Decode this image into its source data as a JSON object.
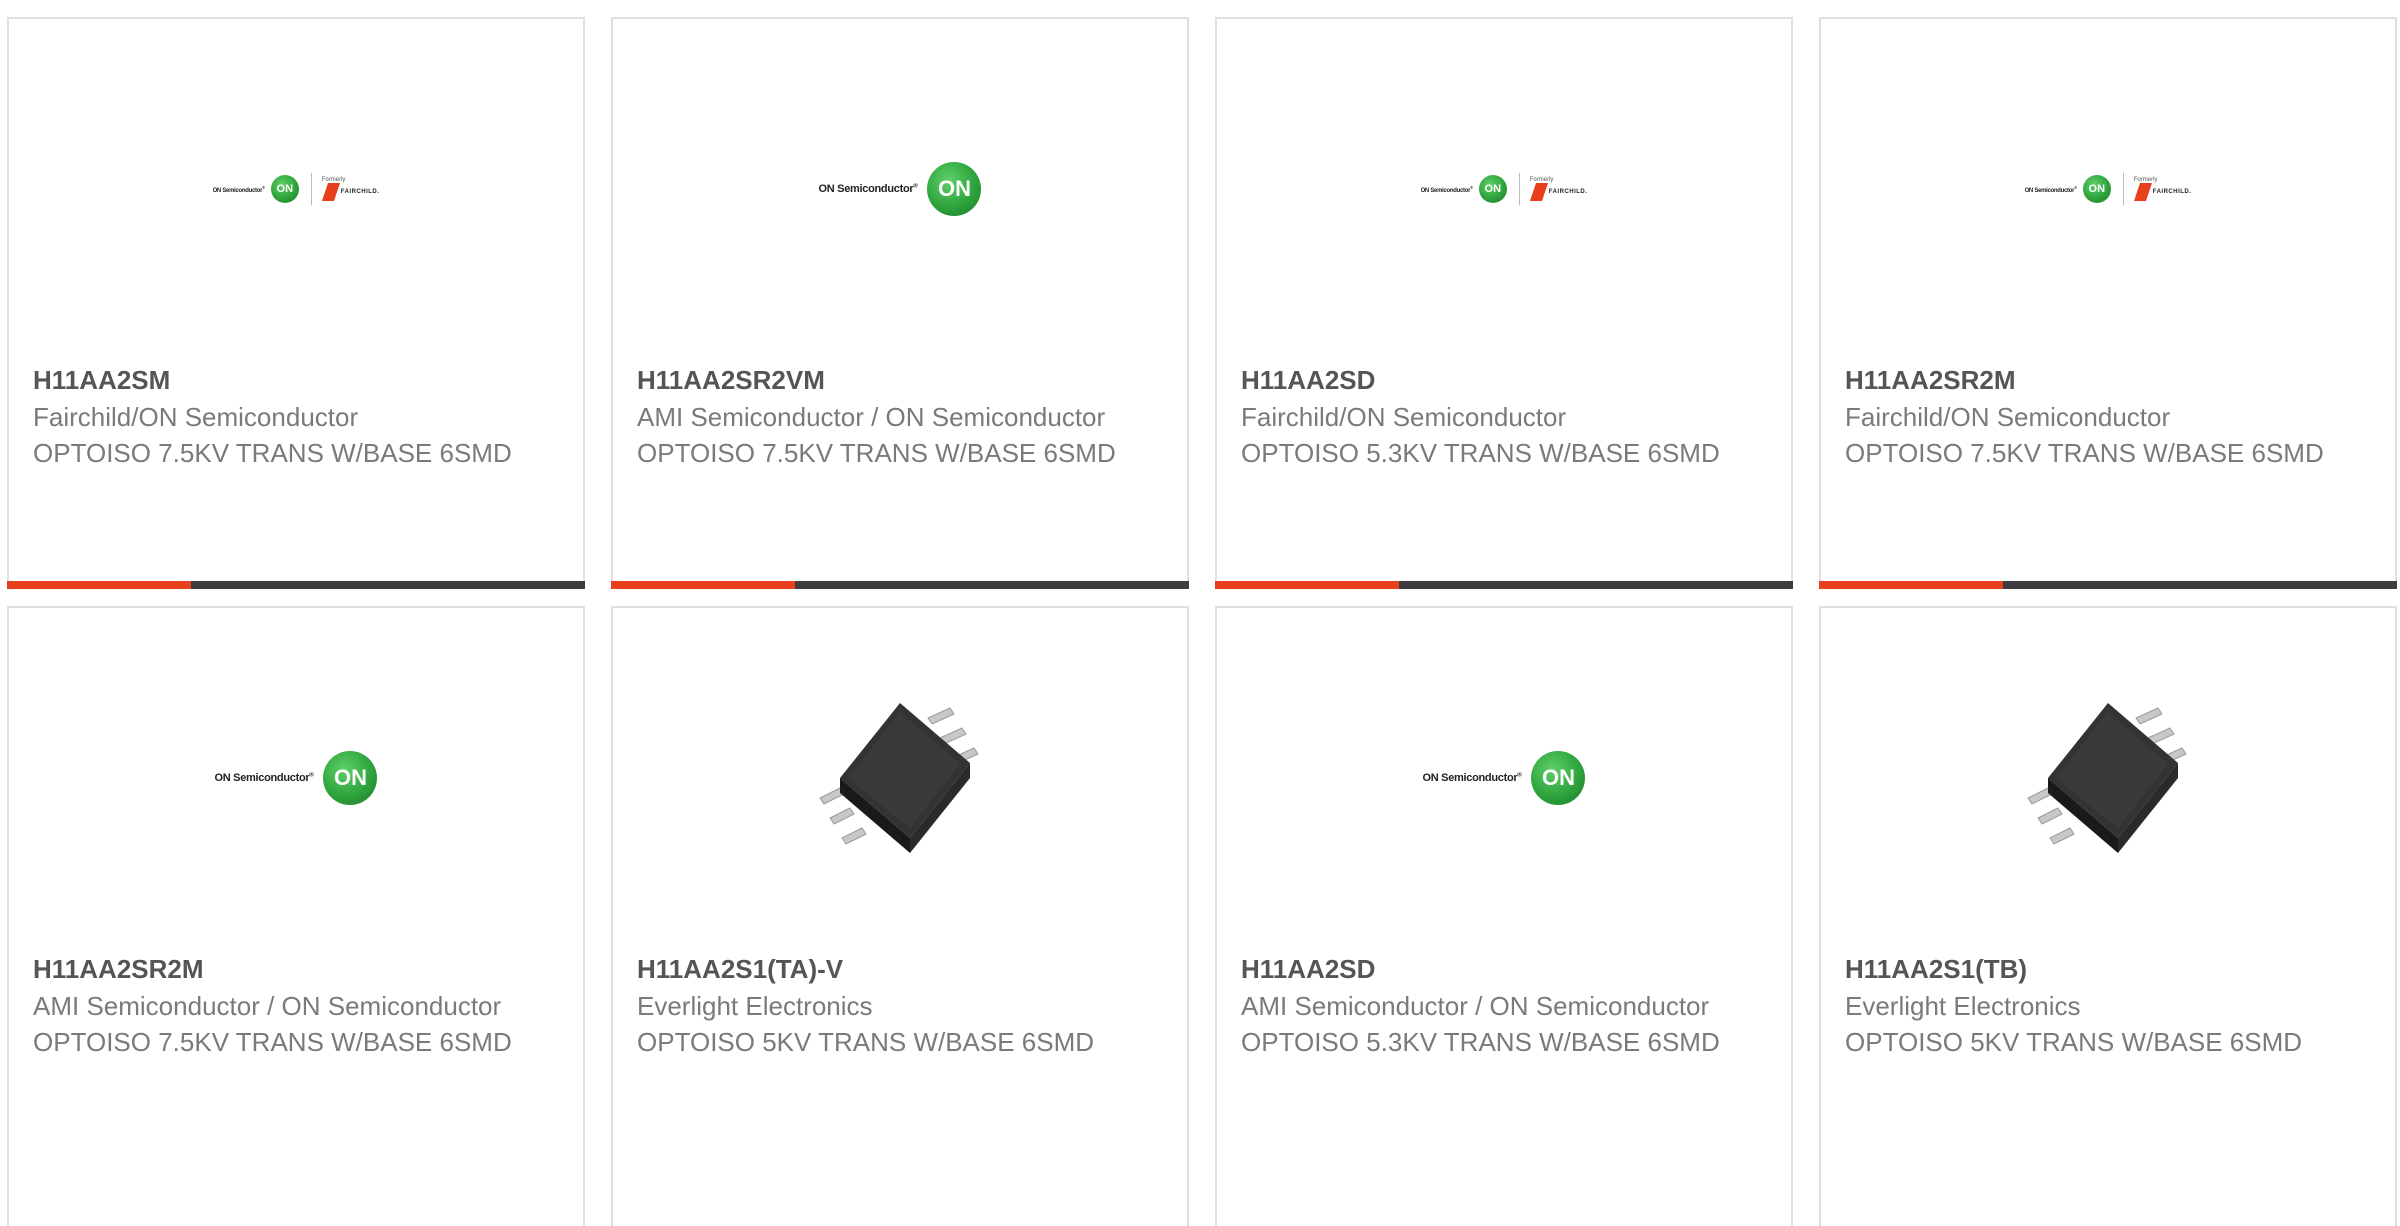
{
  "logos": {
    "on_brand": "ON Semiconductor",
    "on_circle": "ON",
    "fairchild_formerly": "Formerly",
    "fairchild_name": "FAIRCHILD."
  },
  "colors": {
    "accent": "#e8401c",
    "bar": "#3d3d3d",
    "on_green": "#2ea33c"
  },
  "products": [
    {
      "part": "H11AA2SM",
      "maker": "Fairchild/ON Semiconductor",
      "desc": "OPTOISO 7.5KV TRANS W/BASE 6SMD",
      "image": "on-fairchild-logo"
    },
    {
      "part": "H11AA2SR2VM",
      "maker": "AMI Semiconductor / ON Semiconductor",
      "desc": "OPTOISO 7.5KV TRANS W/BASE 6SMD",
      "image": "on-semiconductor-logo"
    },
    {
      "part": "H11AA2SD",
      "maker": "Fairchild/ON Semiconductor",
      "desc": "OPTOISO 5.3KV TRANS W/BASE 6SMD",
      "image": "on-fairchild-logo"
    },
    {
      "part": "H11AA2SR2M",
      "maker": "Fairchild/ON Semiconductor",
      "desc": "OPTOISO 7.5KV TRANS W/BASE 6SMD",
      "image": "on-fairchild-logo"
    },
    {
      "part": "H11AA2SR2M",
      "maker": "AMI Semiconductor / ON Semiconductor",
      "desc": "OPTOISO 7.5KV TRANS W/BASE 6SMD",
      "image": "on-semiconductor-logo"
    },
    {
      "part": "H11AA2S1(TA)-V",
      "maker": "Everlight Electronics",
      "desc": "OPTOISO 5KV TRANS W/BASE 6SMD",
      "image": "smd-chip-photo"
    },
    {
      "part": "H11AA2SD",
      "maker": "AMI Semiconductor / ON Semiconductor",
      "desc": "OPTOISO 5.3KV TRANS W/BASE 6SMD",
      "image": "on-semiconductor-logo"
    },
    {
      "part": "H11AA2S1(TB)",
      "maker": "Everlight Electronics",
      "desc": "OPTOISO 5KV TRANS W/BASE 6SMD",
      "image": "smd-chip-photo"
    }
  ]
}
